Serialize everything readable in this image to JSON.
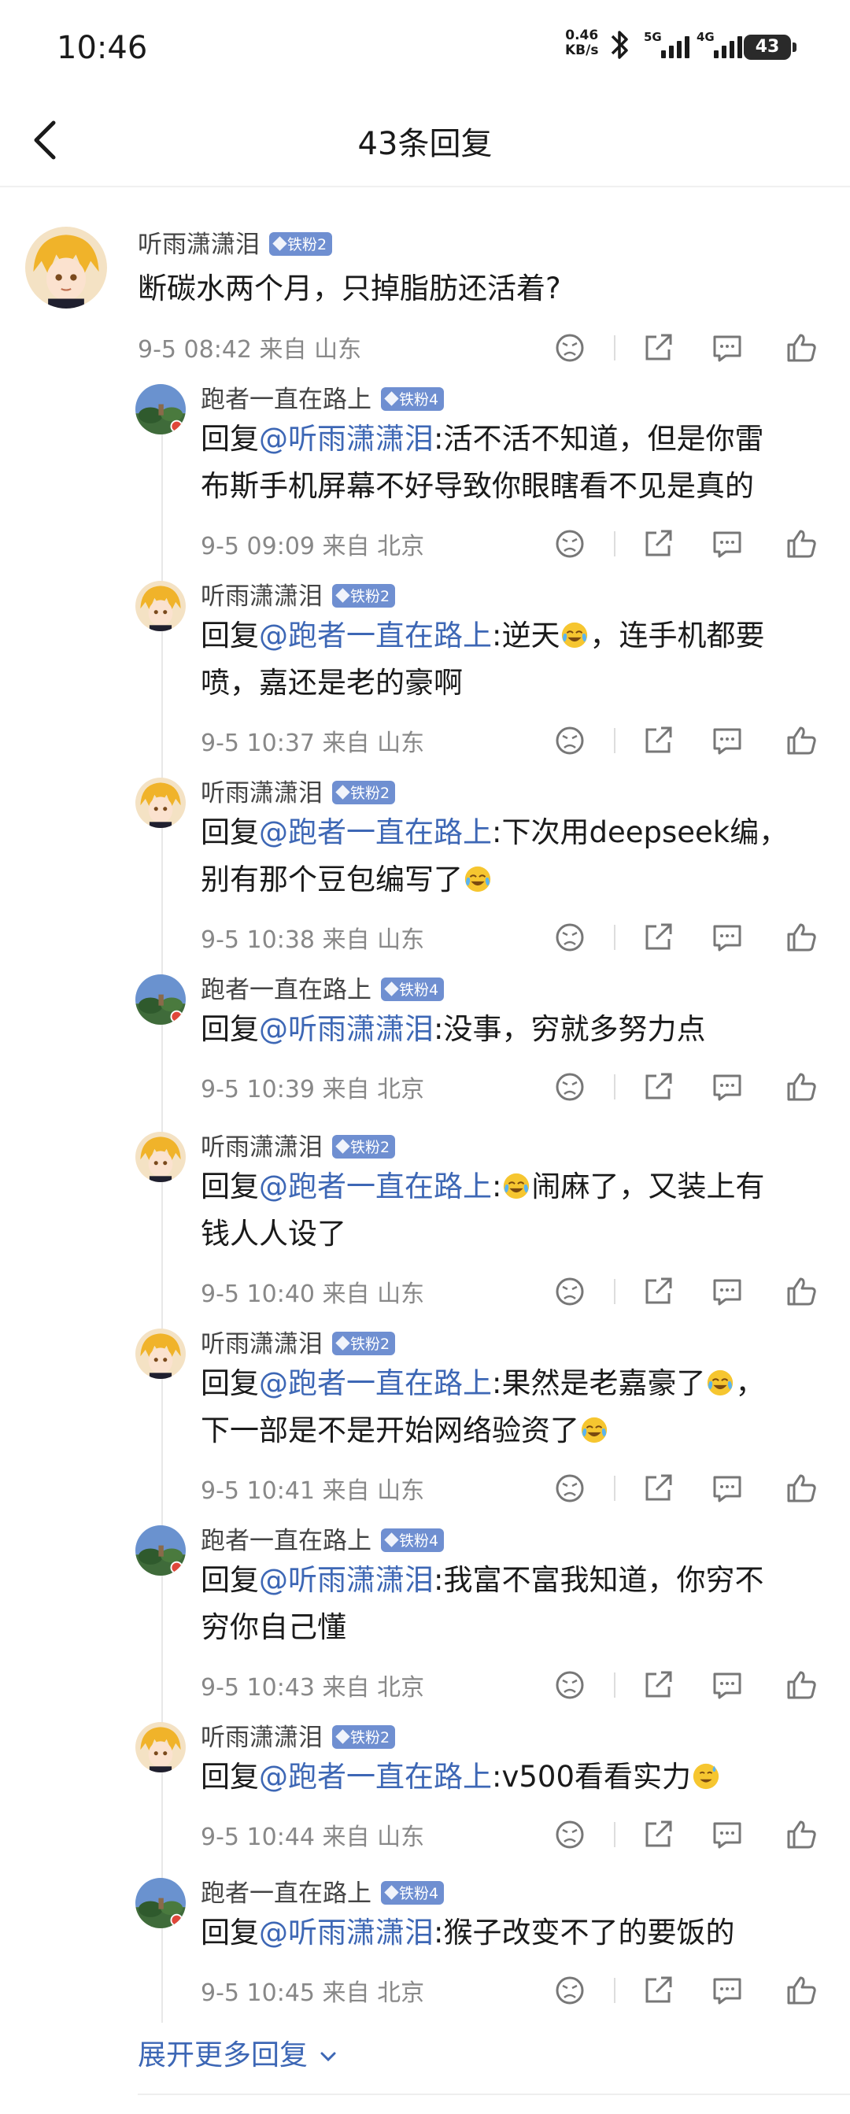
{
  "status_bar": {
    "time": "10:46",
    "net_speed_value": "0.46",
    "net_speed_unit": "KB/s",
    "sig1_label": "5G",
    "sig2_label": "4G",
    "battery": "43"
  },
  "header": {
    "title": "43条回复"
  },
  "main_comment": {
    "username": "听雨潇潇泪",
    "badge": "铁粉2",
    "text": "断碳水两个月，只掉脂肪还活着?",
    "time": "9-5 08:42",
    "location": "来自 山东"
  },
  "replies": [
    {
      "username": "跑者一直在路上",
      "badge": "铁粉4",
      "prefix": "回复",
      "mention": "@听雨潇潇泪",
      "text_lines": [
        ":活不活不知道，但是你雷",
        "布斯手机屏幕不好导致你眼瞎看不见是真的"
      ],
      "time": "9-5 09:09",
      "location": "来自 北京"
    },
    {
      "username": "听雨潇潇泪",
      "badge": "铁粉2",
      "prefix": "回复",
      "mention": "@跑者一直在路上",
      "text_lines": [
        ":逆天",
        "，连手机都要",
        "喷，嘉还是老的豪啊"
      ],
      "time": "9-5 10:37",
      "location": "来自 山东"
    },
    {
      "username": "听雨潇潇泪",
      "badge": "铁粉2",
      "prefix": "回复",
      "mention": "@跑者一直在路上",
      "text_lines": [
        ":下次用deepseek编，",
        "别有那个豆包编写了"
      ],
      "time": "9-5 10:38",
      "location": "来自 山东"
    },
    {
      "username": "跑者一直在路上",
      "badge": "铁粉4",
      "prefix": "回复",
      "mention": "@听雨潇潇泪",
      "text_lines": [
        ":没事，穷就多努力点"
      ],
      "time": "9-5 10:39",
      "location": "来自 北京"
    },
    {
      "username": "听雨潇潇泪",
      "badge": "铁粉2",
      "prefix": "回复",
      "mention": "@跑者一直在路上",
      "text_lines": [
        ":",
        "闹麻了，又装上有",
        "钱人人设了"
      ],
      "time": "9-5 10:40",
      "location": "来自 山东"
    },
    {
      "username": "听雨潇潇泪",
      "badge": "铁粉2",
      "prefix": "回复",
      "mention": "@跑者一直在路上",
      "text_lines": [
        ":果然是老嘉豪了",
        "，",
        "下一部是不是开始网络验资了"
      ],
      "time": "9-5 10:41",
      "location": "来自 山东"
    },
    {
      "username": "跑者一直在路上",
      "badge": "铁粉4",
      "prefix": "回复",
      "mention": "@听雨潇潇泪",
      "text_lines": [
        ":我富不富我知道，你穷不",
        "穷你自己懂"
      ],
      "time": "9-5 10:43",
      "location": "来自 北京"
    },
    {
      "username": "听雨潇潇泪",
      "badge": "铁粉2",
      "prefix": "回复",
      "mention": "@跑者一直在路上",
      "text_lines": [
        ":v500看看实力"
      ],
      "time": "9-5 10:44",
      "location": "来自 山东"
    },
    {
      "username": "跑者一直在路上",
      "badge": "铁粉4",
      "prefix": "回复",
      "mention": "@听雨潇潇泪",
      "text_lines": [
        ":猴子改变不了的要饭的"
      ],
      "time": "9-5 10:45",
      "location": "来自 北京"
    }
  ],
  "more_replies_label": "展开更多回复",
  "colors": {
    "link": "#3d67b5",
    "badge": "#6f8fd1",
    "meta": "#888888"
  }
}
